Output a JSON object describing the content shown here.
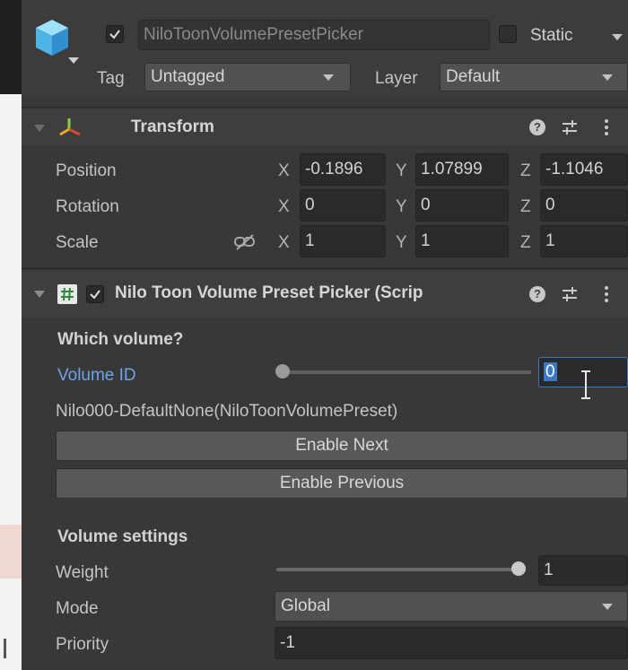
{
  "header": {
    "object_active": true,
    "object_name": "NiloToonVolumePresetPicker",
    "static_label": "Static",
    "static_checked": false,
    "tag_label": "Tag",
    "tag_value": "Untagged",
    "layer_label": "Layer",
    "layer_value": "Default"
  },
  "transform": {
    "title": "Transform",
    "position": {
      "label": "Position",
      "x": "-0.1896",
      "y": "1.07899",
      "z": "-1.1046"
    },
    "rotation": {
      "label": "Rotation",
      "x": "0",
      "y": "0",
      "z": "0"
    },
    "scale": {
      "label": "Scale",
      "x": "1",
      "y": "1",
      "z": "1"
    },
    "axis_x": "X",
    "axis_y": "Y",
    "axis_z": "Z"
  },
  "component": {
    "enabled": true,
    "title": "Nilo Toon Volume Preset Picker (Scrip",
    "section_which": "Which volume?",
    "volume_id_label": "Volume ID",
    "volume_id_value": "0",
    "volume_id_slider": 0,
    "preset_name": "Nilo000-DefaultNone(NiloToonVolumePreset)",
    "enable_next": "Enable Next",
    "enable_previous": "Enable Previous",
    "section_settings": "Volume settings",
    "weight_label": "Weight",
    "weight_value": "1",
    "weight_slider": 1,
    "mode_label": "Mode",
    "mode_value": "Global",
    "priority_label": "Priority",
    "priority_value": "-1"
  },
  "colors": {
    "panel_bg": "#383838",
    "field_bg": "#2a2a2a",
    "highlight_label": "#6fa3e8",
    "focus_border": "#3a79c4"
  }
}
